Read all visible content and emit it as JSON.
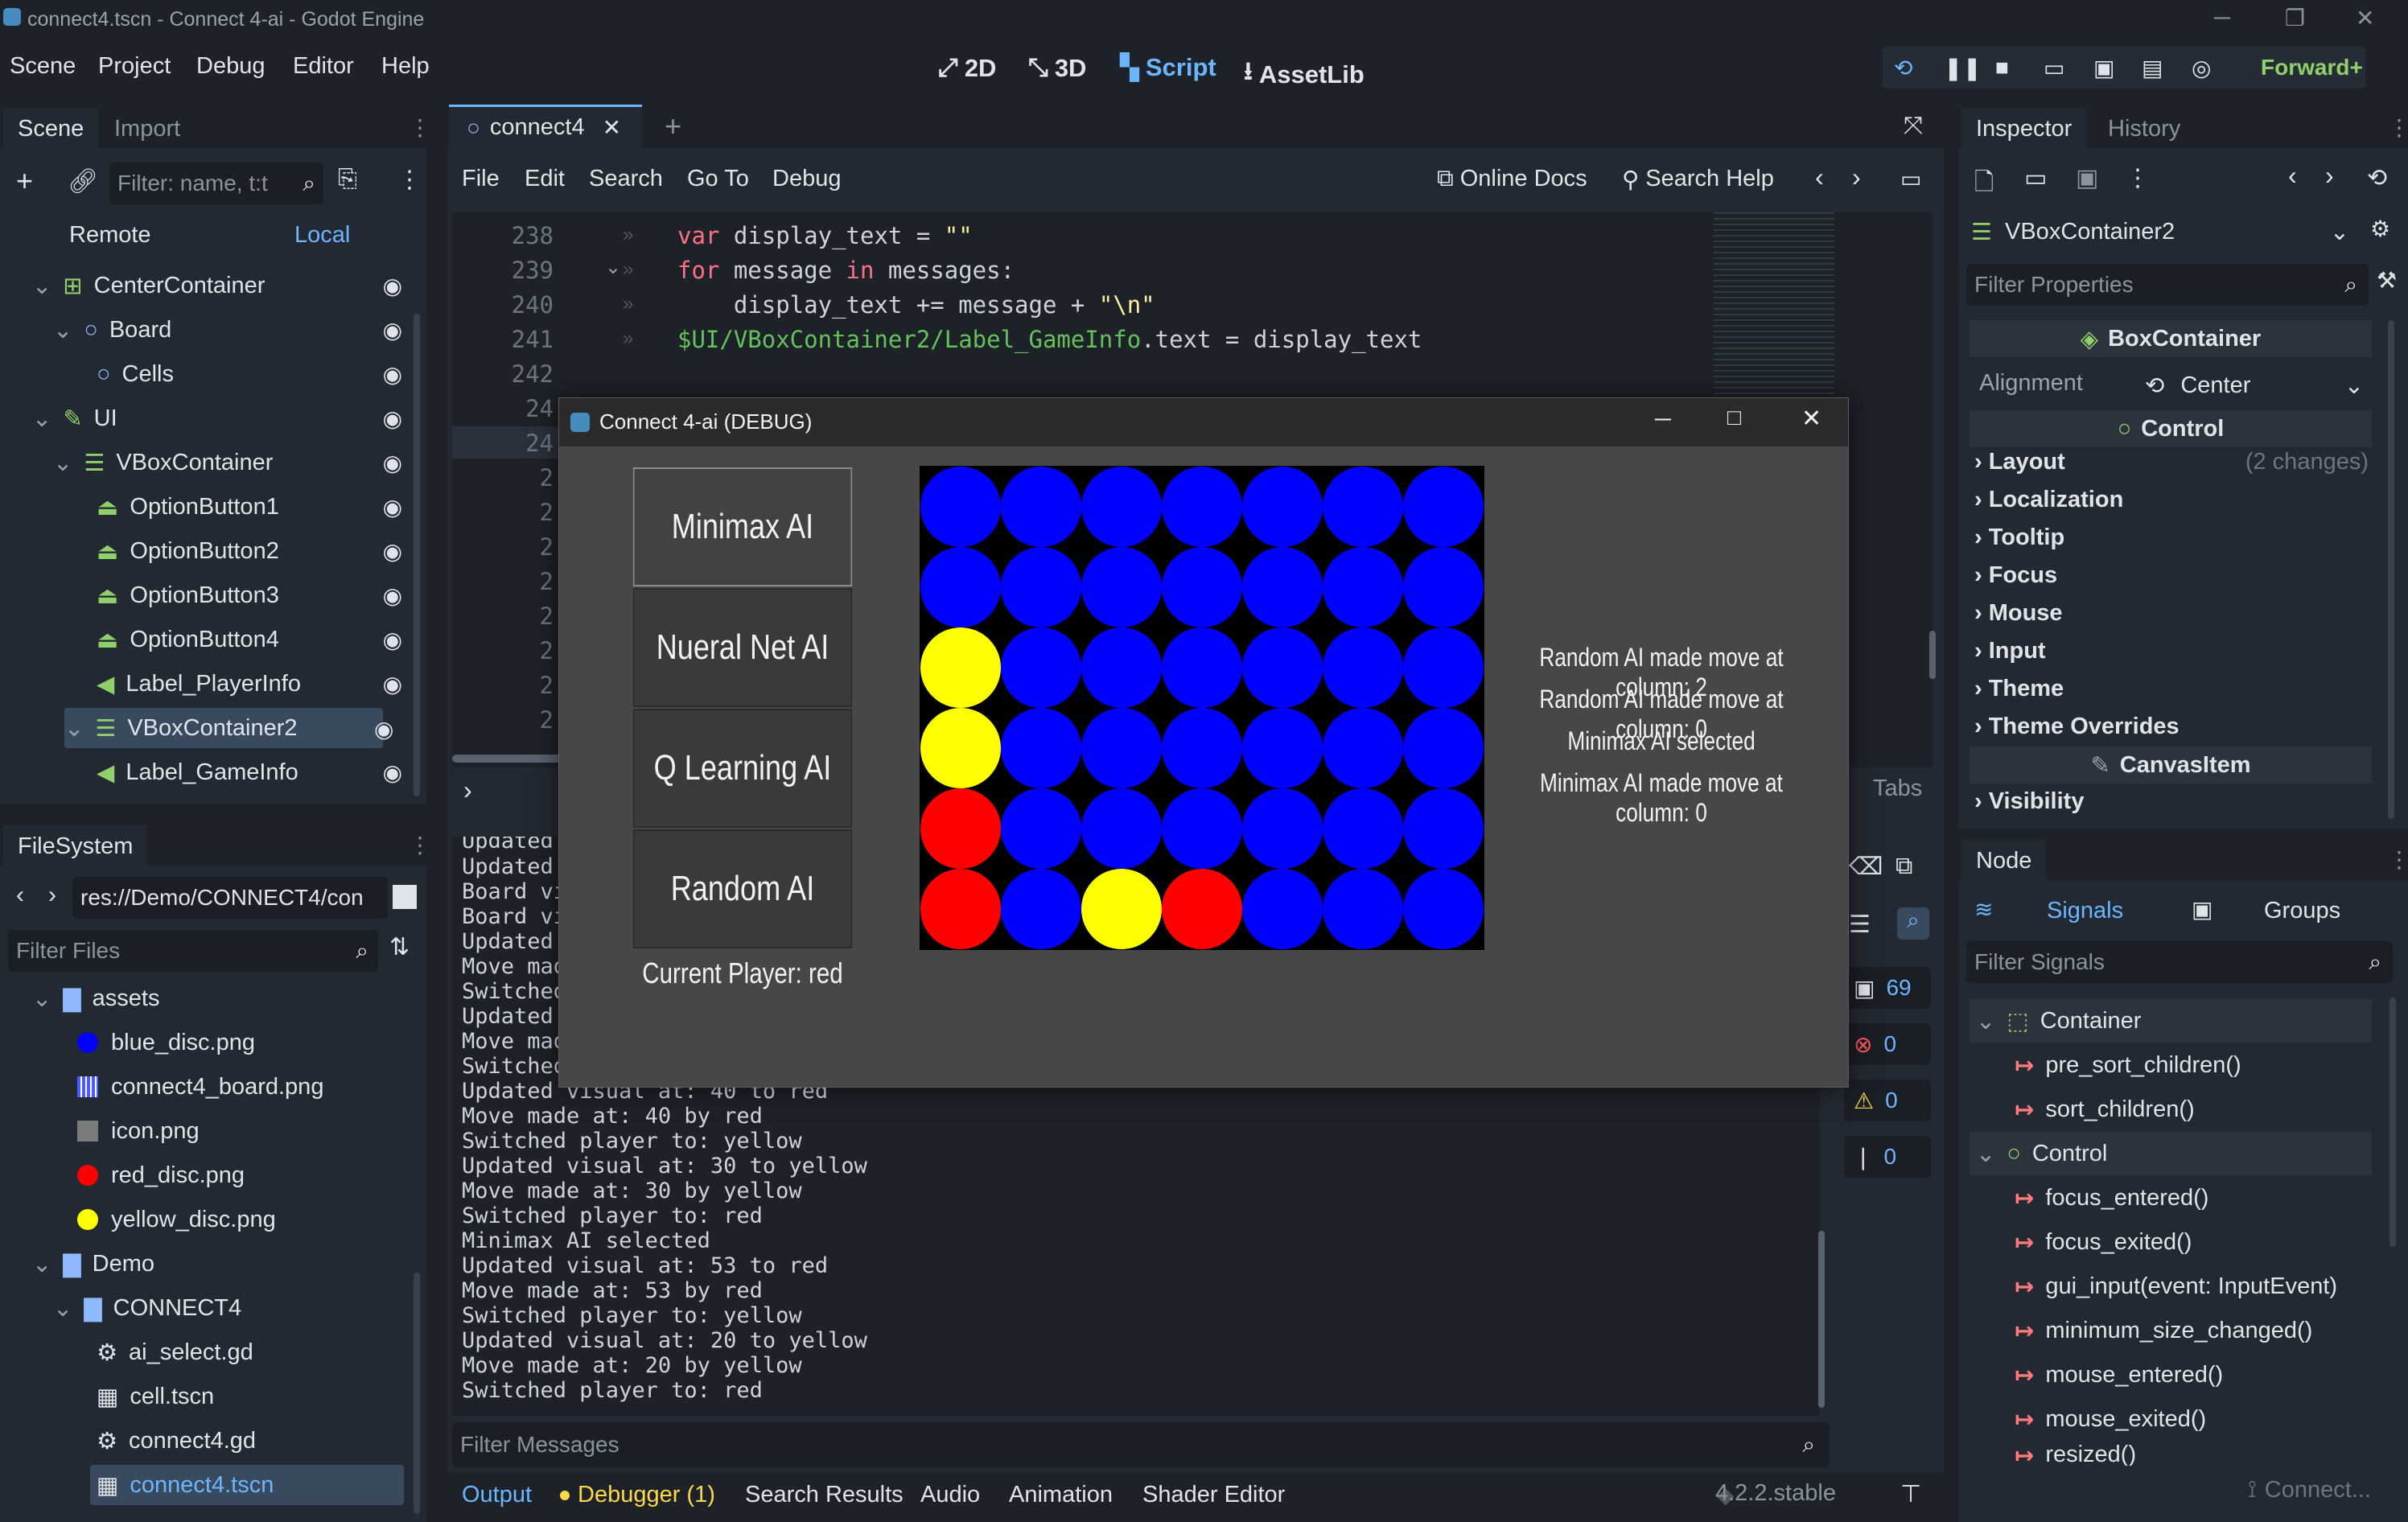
{
  "window": {
    "title": "connect4.tscn - Connect 4-ai - Godot Engine"
  },
  "menu": [
    "Scene",
    "Project",
    "Debug",
    "Editor",
    "Help"
  ],
  "workspaces": [
    {
      "label": "2D",
      "icon": "2d-icon"
    },
    {
      "label": "3D",
      "icon": "3d-icon"
    },
    {
      "label": "Script",
      "icon": "script-icon",
      "active": true
    },
    {
      "label": "AssetLib",
      "icon": "assetlib-icon"
    }
  ],
  "renderer": "Forward+",
  "scene_dock": {
    "tabs": [
      "Scene",
      "Import"
    ],
    "filter_placeholder": "Filter: name, t:t",
    "remote": "Remote",
    "local": "Local",
    "tree": [
      {
        "label": "CenterContainer",
        "indent": 0,
        "icon": "green-container-icon"
      },
      {
        "label": "Board",
        "indent": 1,
        "icon": "node2d-circle-icon"
      },
      {
        "label": "Cells",
        "indent": 2,
        "icon": "node2d-circle-icon"
      },
      {
        "label": "UI",
        "indent": 0,
        "icon": "control-icon"
      },
      {
        "label": "VBoxContainer",
        "indent": 1,
        "icon": "vbox-icon"
      },
      {
        "label": "OptionButton1",
        "indent": 2,
        "icon": "option-button-icon"
      },
      {
        "label": "OptionButton2",
        "indent": 2,
        "icon": "option-button-icon"
      },
      {
        "label": "OptionButton3",
        "indent": 2,
        "icon": "option-button-icon"
      },
      {
        "label": "OptionButton4",
        "indent": 2,
        "icon": "option-button-icon"
      },
      {
        "label": "Label_PlayerInfo",
        "indent": 2,
        "icon": "label-icon"
      },
      {
        "label": "VBoxContainer2",
        "indent": 1,
        "icon": "vbox-icon",
        "selected": true
      },
      {
        "label": "Label_GameInfo",
        "indent": 2,
        "icon": "label-icon"
      }
    ]
  },
  "filesystem": {
    "title": "FileSystem",
    "path": "res://Demo/CONNECT4/con",
    "filter_placeholder": "Filter Files",
    "items": [
      {
        "label": "assets",
        "indent": 0,
        "icon": "folder-icon"
      },
      {
        "label": "blue_disc.png",
        "indent": 1,
        "icon": "blue-disc-icon"
      },
      {
        "label": "connect4_board.png",
        "indent": 1,
        "icon": "board-image-icon"
      },
      {
        "label": "icon.png",
        "indent": 1,
        "icon": "image-icon"
      },
      {
        "label": "red_disc.png",
        "indent": 1,
        "icon": "red-disc-icon"
      },
      {
        "label": "yellow_disc.png",
        "indent": 1,
        "icon": "yellow-disc-icon"
      },
      {
        "label": "Demo",
        "indent": 0,
        "icon": "folder-icon"
      },
      {
        "label": "CONNECT4",
        "indent": 1,
        "icon": "folder-icon"
      },
      {
        "label": "ai_select.gd",
        "indent": 2,
        "icon": "gear-icon"
      },
      {
        "label": "cell.tscn",
        "indent": 2,
        "icon": "scene-icon"
      },
      {
        "label": "connect4.gd",
        "indent": 2,
        "icon": "gear-icon"
      },
      {
        "label": "connect4.tscn",
        "indent": 2,
        "icon": "scene-icon",
        "selected": true
      }
    ]
  },
  "script_editor": {
    "tab": "connect4",
    "menu": [
      "File",
      "Edit",
      "Search",
      "Go To",
      "Debug"
    ],
    "online_docs": "Online Docs",
    "search_help": "Search Help",
    "tabs_label": "Tabs",
    "lines": [
      {
        "num": "238",
        "code": "var display_text = \"\""
      },
      {
        "num": "239",
        "code": "for message in messages:"
      },
      {
        "num": "240",
        "code": "    display_text += message + \"\\n\""
      },
      {
        "num": "241",
        "code": "$UI/VBoxContainer2/Label_GameInfo.text = display_text"
      },
      {
        "num": "242",
        "code": ""
      },
      {
        "num": "24",
        "code": ""
      },
      {
        "num": "24",
        "code": ""
      },
      {
        "num": "2",
        "code": ""
      },
      {
        "num": "2",
        "code": ""
      },
      {
        "num": "2",
        "code": ""
      },
      {
        "num": "2",
        "code": ""
      },
      {
        "num": "2",
        "code": ""
      },
      {
        "num": "2",
        "code": ""
      },
      {
        "num": "2",
        "code": ""
      },
      {
        "num": "2",
        "code": ""
      }
    ]
  },
  "output": {
    "lines": [
      "Updated",
      "Updated",
      "Board vi",
      "Board vi",
      "Updated",
      "Move mad",
      "Switched",
      "Updated",
      "Move mad",
      "Switched",
      "Updated visual at: 40 to red",
      "Move made at: 40 by red",
      "Switched player to: yellow",
      "Updated visual at: 30 to yellow",
      "Move made at: 30 by yellow",
      "Switched player to: red",
      "Minimax AI selected",
      "Updated visual at: 53 to red",
      "Move made at: 53 by red",
      "Switched player to: yellow",
      "Updated visual at: 20 to yellow",
      "Move made at: 20 by yellow",
      "Switched player to: red"
    ],
    "filter_placeholder": "Filter Messages",
    "counts": {
      "messages": "69",
      "errors": "0",
      "warnings": "0",
      "info": "0"
    }
  },
  "bottom_tabs": [
    "Output",
    "Debugger (1)",
    "Search Results",
    "Audio",
    "Animation",
    "Shader Editor"
  ],
  "version": "4.2.2.stable",
  "game": {
    "title": "Connect 4-ai (DEBUG)",
    "buttons": [
      "Minimax AI",
      "Nueral Net AI",
      "Q Learning AI",
      "Random AI"
    ],
    "current_player": "Current Player: red",
    "info": [
      "Random AI made move at column: 2",
      "Random AI made move at column: 0",
      "Minimax AI selected",
      "Minimax AI made move at column: 0"
    ],
    "board": [
      [
        "B",
        "B",
        "B",
        "B",
        "B",
        "B",
        "B"
      ],
      [
        "B",
        "B",
        "B",
        "B",
        "B",
        "B",
        "B"
      ],
      [
        "Y",
        "B",
        "B",
        "B",
        "B",
        "B",
        "B"
      ],
      [
        "Y",
        "B",
        "B",
        "B",
        "B",
        "B",
        "B"
      ],
      [
        "R",
        "B",
        "B",
        "B",
        "B",
        "B",
        "B"
      ],
      [
        "R",
        "B",
        "Y",
        "R",
        "B",
        "B",
        "B"
      ]
    ],
    "colors": {
      "B": "#0000ff",
      "Y": "#ffff00",
      "R": "#ff0000",
      "bg": "#000000"
    }
  },
  "inspector": {
    "tabs": [
      "Inspector",
      "History"
    ],
    "node": "VBoxContainer2",
    "filter_placeholder": "Filter Properties",
    "boxcontainer": "BoxContainer",
    "alignment_label": "Alignment",
    "alignment_value": "Center",
    "control": "Control",
    "sections": [
      "Layout",
      "Localization",
      "Tooltip",
      "Focus",
      "Mouse",
      "Input",
      "Theme",
      "Theme Overrides"
    ],
    "layout_changes": "(2 changes)",
    "canvasitem": "CanvasItem",
    "visibility": "Visibility"
  },
  "node_dock": {
    "title": "Node",
    "signals_tab": "Signals",
    "groups_tab": "Groups",
    "filter_placeholder": "Filter Signals",
    "container_header": "Container",
    "container_signals": [
      "pre_sort_children()",
      "sort_children()"
    ],
    "control_header": "Control",
    "control_signals": [
      "focus_entered()",
      "focus_exited()",
      "gui_input(event: InputEvent)",
      "minimum_size_changed()",
      "mouse_entered()",
      "mouse_exited()",
      "resized()"
    ],
    "connect": "Connect..."
  }
}
